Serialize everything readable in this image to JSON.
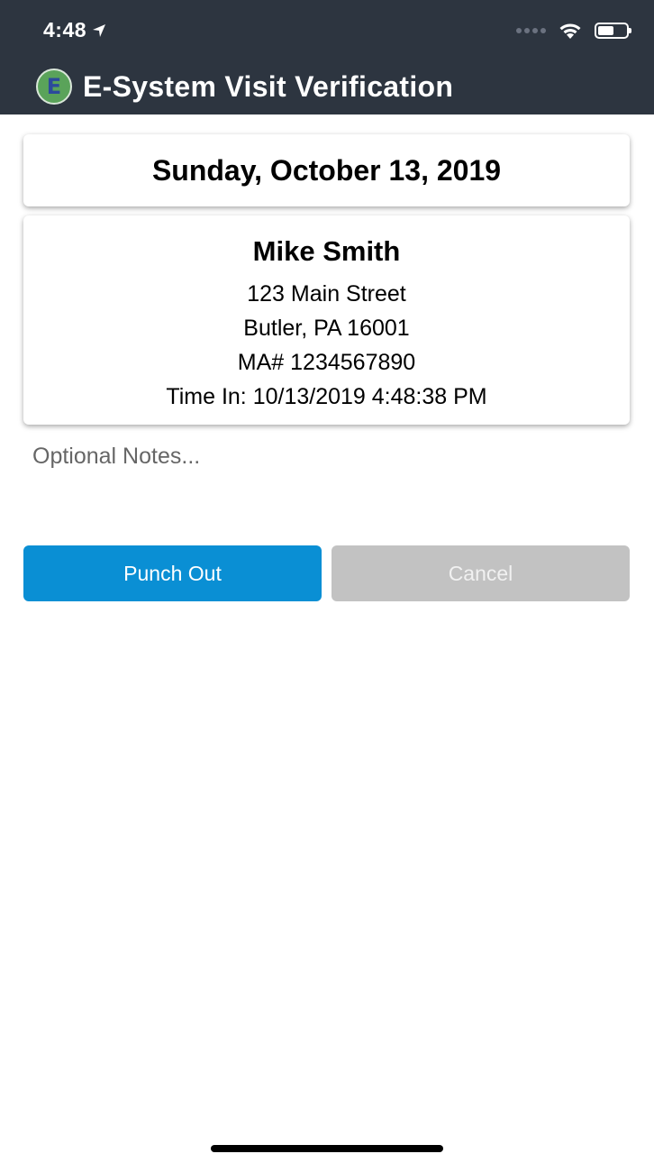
{
  "status_bar": {
    "time": "4:48"
  },
  "header": {
    "logo_letter": "E",
    "title": "E-System Visit Verification"
  },
  "date_card": {
    "date": "Sunday, October 13, 2019"
  },
  "client_card": {
    "name": "Mike Smith",
    "street": "123 Main Street",
    "city_state_zip": "Butler, PA 16001",
    "ma_number": "MA# 1234567890",
    "time_in": "Time In: 10/13/2019 4:48:38 PM"
  },
  "notes": {
    "placeholder": "Optional Notes...",
    "value": ""
  },
  "actions": {
    "punch_out_label": "Punch Out",
    "cancel_label": "Cancel"
  },
  "colors": {
    "header_bg": "#2d3540",
    "primary": "#0a8fd4",
    "disabled": "#c2c2c2"
  },
  "icons": {
    "location": "location-arrow-icon",
    "wifi": "wifi-icon",
    "battery": "battery-icon",
    "signal": "cellular-signal-icon",
    "logo": "app-logo-icon"
  },
  "battery": {
    "level": 0.55
  }
}
